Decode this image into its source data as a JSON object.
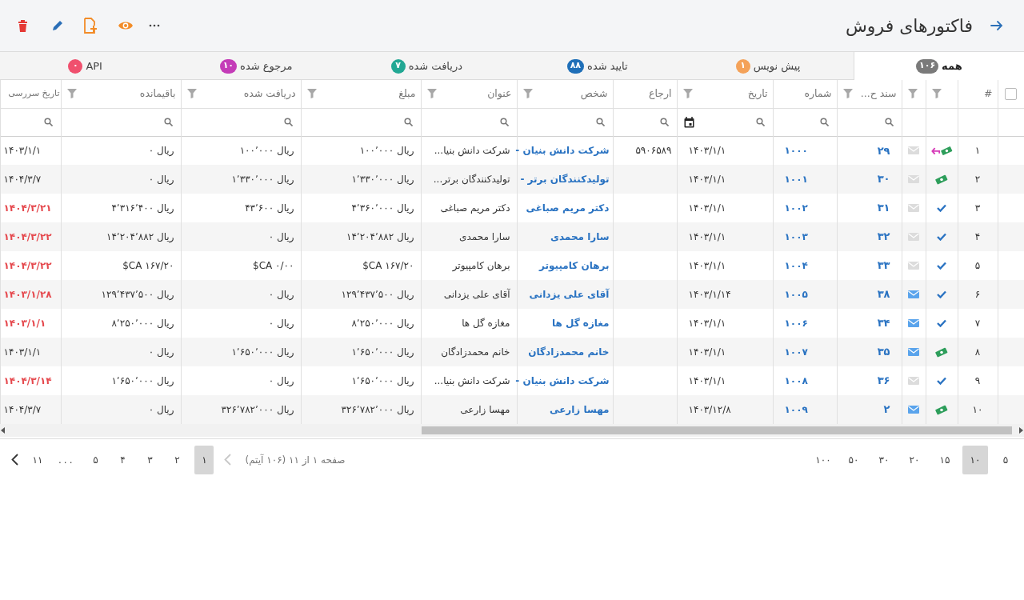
{
  "header": {
    "title": "فاکتورهای فروش"
  },
  "tabs": [
    {
      "label": "همه",
      "count": "۱۰۶",
      "color": "#7a7a7a",
      "selected": true
    },
    {
      "label": "پیش نویس",
      "count": "۱",
      "color": "#f4a259",
      "selected": false
    },
    {
      "label": "تایید شده",
      "count": "۸۸",
      "color": "#1f6fb8",
      "selected": false
    },
    {
      "label": "دریافت شده",
      "count": "۷",
      "color": "#22a894",
      "selected": false
    },
    {
      "label": "مرجوع شده",
      "count": "۱۰",
      "color": "#c43cb8",
      "selected": false
    },
    {
      "label": "API",
      "count": "۰",
      "color": "#f0506e",
      "selected": false
    }
  ],
  "table": {
    "select_all": {
      "checked": false
    },
    "columns": [
      {
        "kind": "select"
      },
      {
        "label": "#",
        "filter": false
      },
      {
        "filter": true
      },
      {
        "filter": true
      },
      {
        "label": "سند ح...",
        "filter": true,
        "search": true,
        "date_picker": false
      },
      {
        "label": "شماره",
        "filter": false,
        "search": true,
        "date_picker": false
      },
      {
        "label": "تاریخ",
        "filter": true,
        "search": true,
        "date_picker": true
      },
      {
        "label": "ارجاع",
        "filter": false,
        "search": true,
        "date_picker": false
      },
      {
        "label": "شخص",
        "filter": true,
        "search": true,
        "date_picker": false
      },
      {
        "label": "عنوان",
        "filter": true,
        "search": true,
        "date_picker": false
      },
      {
        "label": "مبلغ",
        "filter": true,
        "search": true,
        "date_picker": false
      },
      {
        "label": "دریافت شده",
        "filter": true,
        "search": true,
        "date_picker": false
      },
      {
        "label": "باقیمانده",
        "filter": true,
        "search": true,
        "date_picker": false
      },
      {
        "label": "تاریخ سررسی",
        "search": true,
        "date_picker": false
      }
    ],
    "rows": [
      {
        "index": "۱",
        "kind": "returned",
        "emailed": false,
        "doc": "۲۹",
        "number": "۱۰۰۰",
        "date": "۱۴۰۳/۱/۱",
        "ref": "۵۹۰۶۵۸۹",
        "person": "شرکت دانش بنیان -",
        "title": "شرکت دانش بنیا...",
        "amount": "ریال ۱۰۰٬۰۰۰",
        "received": "ریال ۱۰۰٬۰۰۰",
        "remaining": "ریال ۰",
        "due": "۱۴۰۳/۱/۱",
        "overdue": false
      },
      {
        "index": "۲",
        "kind": "paid",
        "emailed": false,
        "doc": "۳۰",
        "number": "۱۰۰۱",
        "date": "۱۴۰۳/۱/۱",
        "person": "تولیدکنندگان برتر -",
        "title": "تولیدکنندگان برتر...",
        "amount": "ریال ۱٬۳۳۰٬۰۰۰",
        "received": "ریال ۱٬۳۳۰٬۰۰۰",
        "remaining": "ریال ۰",
        "due": "۱۴۰۴/۳/۷",
        "overdue": false
      },
      {
        "index": "۳",
        "kind": "approved",
        "emailed": false,
        "doc": "۳۱",
        "number": "۱۰۰۲",
        "date": "۱۴۰۳/۱/۱",
        "person": "دکتر مریم صباغی",
        "title": "دکتر مریم صباغی",
        "amount": "ریال ۴٬۳۶۰٬۰۰۰",
        "received": "ریال ۴۳٬۶۰۰",
        "remaining": "ریال ۴٬۳۱۶٬۴۰۰",
        "due": "۱۴۰۴/۳/۲۱",
        "overdue": true
      },
      {
        "index": "۴",
        "kind": "approved",
        "emailed": false,
        "doc": "۳۲",
        "number": "۱۰۰۳",
        "date": "۱۴۰۳/۱/۱",
        "person": "سارا محمدی",
        "title": "سارا محمدی",
        "amount": "ریال ۱۴٬۲۰۴٬۸۸۲",
        "received": "ریال ۰",
        "remaining": "ریال ۱۴٬۲۰۴٬۸۸۲",
        "due": "۱۴۰۴/۳/۲۲",
        "overdue": true
      },
      {
        "index": "۵",
        "kind": "approved",
        "emailed": false,
        "doc": "۳۳",
        "number": "۱۰۰۴",
        "date": "۱۴۰۳/۱/۱",
        "person": "برهان کامپیوتر",
        "title": "برهان کامپیوتر",
        "amount": "$CA ۱۶۷/۲۰",
        "received": "$CA ۰/۰۰",
        "remaining": "$CA ۱۶۷/۲۰",
        "due": "۱۴۰۴/۳/۲۲",
        "overdue": true
      },
      {
        "index": "۶",
        "kind": "approved",
        "emailed": true,
        "doc": "۳۸",
        "number": "۱۰۰۵",
        "date": "۱۴۰۳/۱/۱۴",
        "person": "آقای علی یزدانی",
        "title": "آقای علی یزدانی",
        "amount": "ریال ۱۲۹٬۴۳۷٬۵۰۰",
        "received": "ریال ۰",
        "remaining": "ریال ۱۲۹٬۴۳۷٬۵۰۰",
        "due": "۱۴۰۳/۱/۲۸",
        "overdue": true
      },
      {
        "index": "۷",
        "kind": "approved",
        "emailed": true,
        "doc": "۳۴",
        "number": "۱۰۰۶",
        "date": "۱۴۰۳/۱/۱",
        "person": "مغازه گل ها",
        "title": "مغازه گل ها",
        "amount": "ریال ۸٬۲۵۰٬۰۰۰",
        "received": "ریال ۰",
        "remaining": "ریال ۸٬۲۵۰٬۰۰۰",
        "due": "۱۴۰۳/۱/۱",
        "overdue": true
      },
      {
        "index": "۸",
        "kind": "paid",
        "emailed": true,
        "doc": "۳۵",
        "number": "۱۰۰۷",
        "date": "۱۴۰۳/۱/۱",
        "person": "خانم محمدزادگان",
        "title": "خانم محمدزادگان",
        "amount": "ریال ۱٬۶۵۰٬۰۰۰",
        "received": "ریال ۱٬۶۵۰٬۰۰۰",
        "remaining": "ریال ۰",
        "due": "۱۴۰۳/۱/۱",
        "overdue": false
      },
      {
        "index": "۹",
        "kind": "approved",
        "emailed": false,
        "doc": "۳۶",
        "number": "۱۰۰۸",
        "date": "۱۴۰۳/۱/۱",
        "person": "شرکت دانش بنیان -",
        "title": "شرکت دانش بنیا...",
        "amount": "ریال ۱٬۶۵۰٬۰۰۰",
        "received": "ریال ۰",
        "remaining": "ریال ۱٬۶۵۰٬۰۰۰",
        "due": "۱۴۰۴/۳/۱۴",
        "overdue": true
      },
      {
        "index": "۱۰",
        "kind": "paid",
        "emailed": true,
        "doc": "۲",
        "number": "۱۰۰۹",
        "date": "۱۴۰۳/۱۲/۸",
        "person": "مهسا زارعی",
        "title": "مهسا زارعی",
        "amount": "ریال ۳۲۶٬۷۸۲٬۰۰۰",
        "received": "ریال ۳۲۶٬۷۸۲٬۰۰۰",
        "remaining": "ریال ۰",
        "due": "۱۴۰۴/۳/۷",
        "overdue": false
      }
    ]
  },
  "pagination": {
    "page_sizes": [
      {
        "label": "۵",
        "selected": false
      },
      {
        "label": "۱۰",
        "selected": true
      },
      {
        "label": "۱۵",
        "selected": false
      },
      {
        "label": "۲۰",
        "selected": false
      },
      {
        "label": "۳۰",
        "selected": false
      },
      {
        "label": "۵۰",
        "selected": false
      },
      {
        "label": "۱۰۰",
        "selected": false
      }
    ],
    "info": "صفحه ۱ از ۱۱ (۱۰۶ آیتم)",
    "prev_disabled": true,
    "next_disabled": false,
    "pages": [
      {
        "label": "۱",
        "selected": true
      },
      {
        "label": "۲",
        "selected": false
      },
      {
        "label": "۳",
        "selected": false
      },
      {
        "label": "۴",
        "selected": false
      },
      {
        "label": "۵",
        "selected": false
      },
      {
        "label": "...",
        "kind": "ellipsis",
        "selected": false
      },
      {
        "label": "۱۱",
        "selected": false
      }
    ]
  }
}
